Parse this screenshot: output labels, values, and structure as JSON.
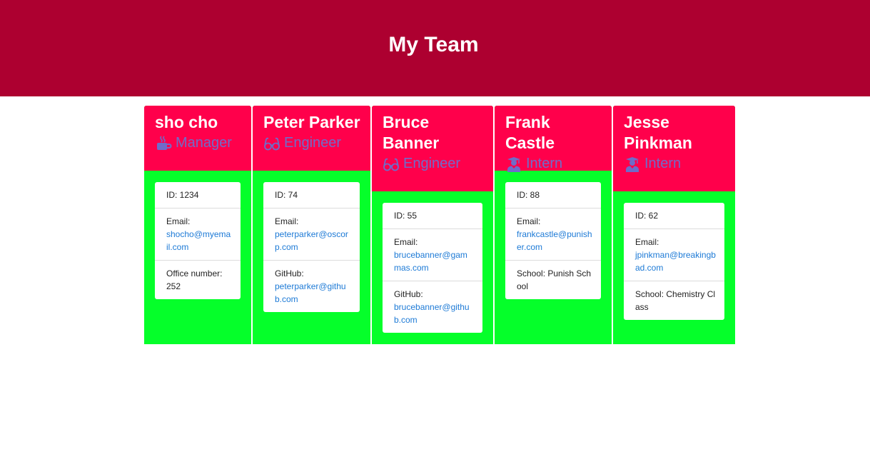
{
  "header": {
    "title": "My Team"
  },
  "colors": {
    "banner": "#ad0030",
    "card_header": "#ff004b",
    "card_body": "#05ff2a",
    "role_text": "#6f6cc9",
    "link": "#1d7ad6"
  },
  "team": [
    {
      "name": "sho cho",
      "role": "Manager",
      "role_icon": "mug-icon",
      "id_text": "ID: 1234",
      "email_label": "Email:",
      "email": "shocho@myemail.com",
      "extra_label": "Office number:",
      "extra_value": "252"
    },
    {
      "name": "Peter Parker",
      "role": "Engineer",
      "role_icon": "glasses-icon",
      "id_text": "ID: 74",
      "email_label": "Email:",
      "email": "peterparker@oscorp.com",
      "extra_label": "GitHub:",
      "extra_value": "peterparker@github.com"
    },
    {
      "name": "Bruce Banner",
      "role": "Engineer",
      "role_icon": "glasses-icon",
      "id_text": "ID: 55",
      "email_label": "Email:",
      "email": "brucebanner@gammas.com",
      "extra_label": "GitHub:",
      "extra_value": "brucebanner@github.com"
    },
    {
      "name": "Frank Castle",
      "role": "Intern",
      "role_icon": "graduate-icon",
      "id_text": "ID: 88",
      "email_label": "Email:",
      "email": "frankcastle@punisher.com",
      "extra_label": "School:",
      "extra_value": "Punish School"
    },
    {
      "name": "Jesse Pinkman",
      "role": "Intern",
      "role_icon": "graduate-icon",
      "id_text": "ID: 62",
      "email_label": "Email:",
      "email": "jpinkman@breakingbad.com",
      "extra_label": "School:",
      "extra_value": "Chemistry Class"
    }
  ]
}
